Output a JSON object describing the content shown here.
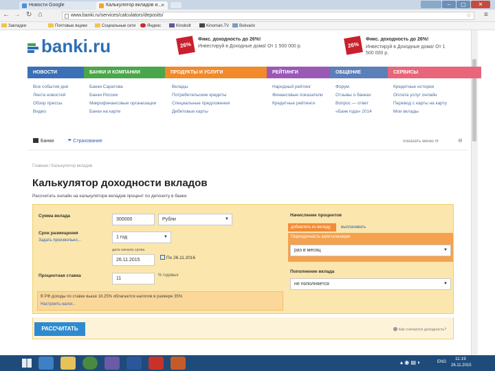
{
  "browser": {
    "tabs": [
      {
        "label": "Новости Google",
        "active": false
      },
      {
        "label": "Калькулятор вкладов и...",
        "active": true
      }
    ],
    "url": "www.banki.ru/services/calculators/deposits/",
    "bookmarks": [
      "Закладки",
      "Почтовые ящики",
      "Социальные сети",
      "Яндекс",
      "Kinobolt",
      "Kinoman.TV",
      "Bukvarix"
    ]
  },
  "site": {
    "logo": "banki.ru",
    "promos": [
      {
        "badge": "26%",
        "title": "Фикс. доходность до 26%!",
        "text": "Инвестируй в Доходные дома! От 1 500 000 р."
      },
      {
        "badge": "26%",
        "title": "Фикс. доходность до 26%!",
        "text": "Инвестируй в Доходные дома! От 1 500 000 р."
      }
    ],
    "nav": [
      {
        "label": "НОВОСТИ",
        "color": "#3b6fb6",
        "items": [
          "Все события дня",
          "Лента новостей",
          "Обзор прессы",
          "Видео"
        ]
      },
      {
        "label": "БАНКИ И КОМПАНИИ",
        "color": "#4aa64a",
        "items": [
          "Банки Саратова",
          "Банки России",
          "Микрофинансовые организации",
          "Банки на карте"
        ]
      },
      {
        "label": "ПРОДУКТЫ И УСЛУГИ",
        "color": "#f08a2b",
        "items": [
          "Вклады",
          "Потребительские кредиты",
          "Специальные предложения",
          "Дебетовые карты"
        ]
      },
      {
        "label": "РЕЙТИНГИ",
        "color": "#9b59b6",
        "items": [
          "Народный рейтинг",
          "Финансовые показатели",
          "Кредитные рейтинги"
        ]
      },
      {
        "label": "ОБЩЕНИЕ",
        "color": "#5b7fb8",
        "items": [
          "Форум",
          "Отзывы о банках",
          "Вопрос — ответ",
          "«Банк года» 2014"
        ]
      },
      {
        "label": "СЕРВИСЫ",
        "color": "#e8657a",
        "items": [
          "Кредитные истории",
          "Оплата услуг онлайн",
          "Перевод с карты на карту",
          "Мои вклады"
        ]
      }
    ],
    "section_tabs": {
      "banks": "Банки",
      "insurance": "Страхование",
      "show_menu": "показать меню"
    }
  },
  "page": {
    "breadcrumb": "Главная / Калькулятор вкладов",
    "title": "Калькулятор доходности вкладов",
    "subtitle": "Рассчитать онлайн на калькуляторе вкладов процент по депозиту в банке",
    "calculator": {
      "amount_label": "Сумма вклада",
      "amount_value": "300000",
      "currency_value": "Рубли",
      "term_label": "Срок размещения",
      "term_link": "Задать произвольно...",
      "term_value": "1 год",
      "open_date_label": "дата начала срока",
      "open_date_value": "26.11.2015",
      "close_date_text": "По 26.11.2016",
      "rate_label": "Процентная ставка",
      "rate_value": "11",
      "rate_unit": "% годовых",
      "interest_label": "Начисление процентов",
      "interest_option_add": "добавлять ко вкладу",
      "interest_option_pay": "выплачивать",
      "frequency_label": "Периодичность капитализации",
      "frequency_value": "раз в месяц",
      "replenish_label": "Пополнение вклада",
      "replenish_value": "не пополняется",
      "info_text": "В РФ доходы по ставке выше 18.25% облагаются налогом в размере 35%",
      "info_link": "Настроить налог...",
      "calculate_button": "РАССЧИТАТЬ",
      "bottom_right_link": "Как считается доходность?"
    }
  },
  "taskbar": {
    "lang": "ENG",
    "time": "11:19",
    "date": "26.11.2015"
  }
}
